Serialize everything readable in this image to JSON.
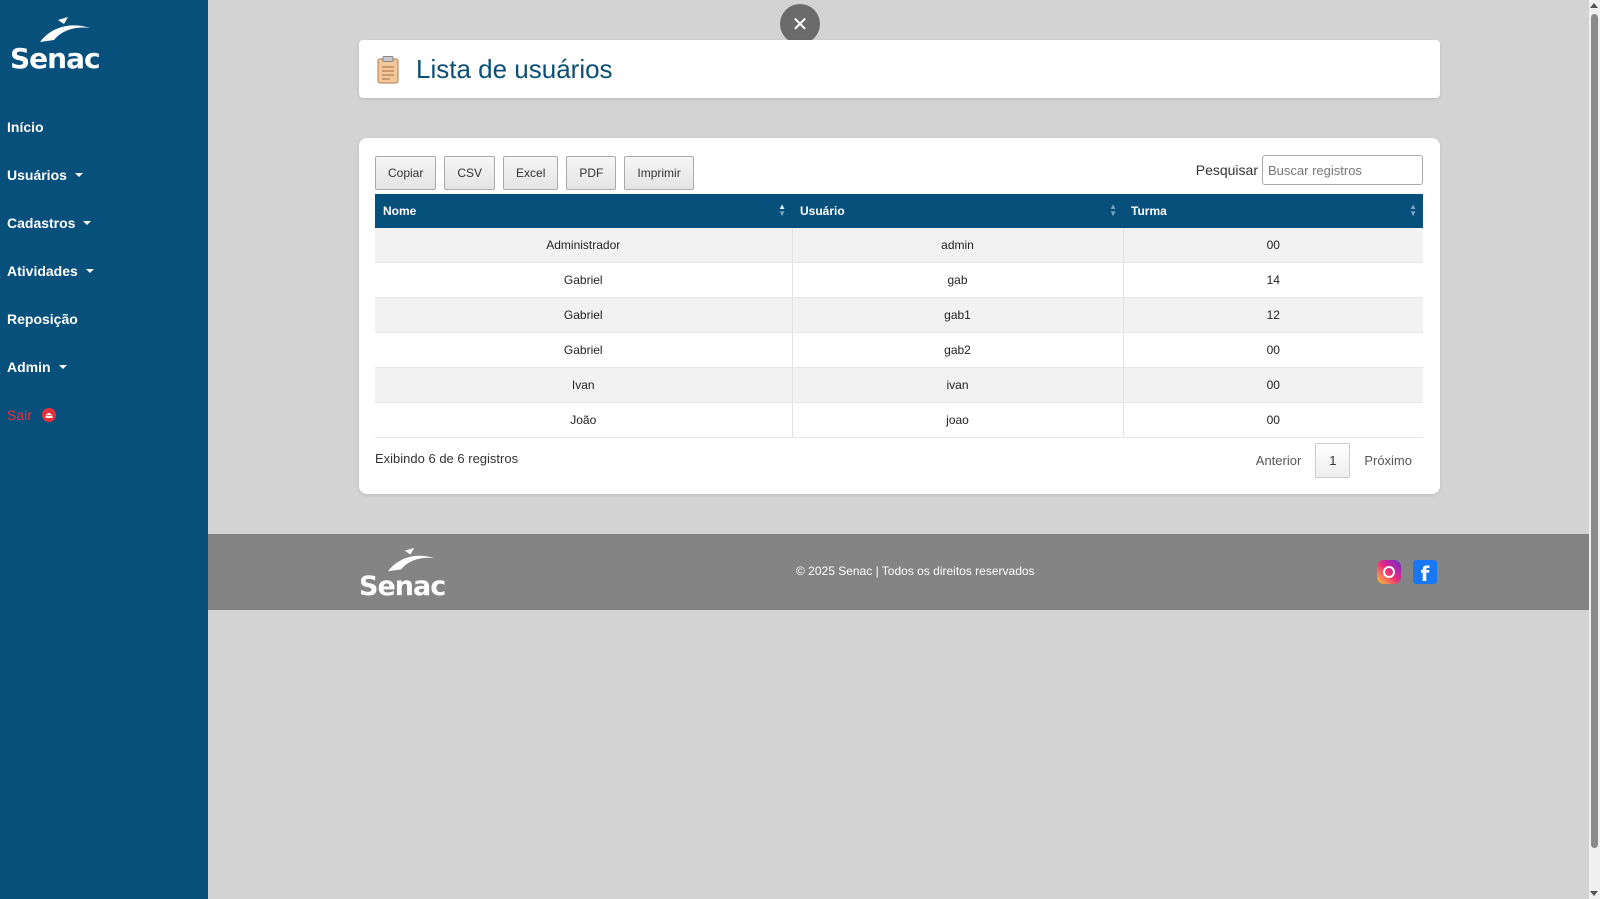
{
  "brand": {
    "logo_text": "Senac"
  },
  "sidebar": {
    "items": [
      {
        "label": "Início",
        "has_caret": false
      },
      {
        "label": "Usuários",
        "has_caret": true
      },
      {
        "label": "Cadastros",
        "has_caret": true
      },
      {
        "label": "Atividades",
        "has_caret": true
      },
      {
        "label": "Reposição",
        "has_caret": false
      },
      {
        "label": "Admin",
        "has_caret": true
      }
    ],
    "logout_label": "Sair"
  },
  "close_button": {
    "icon": "close-icon",
    "glyph": "✕"
  },
  "page": {
    "title": "Lista de usuários",
    "title_icon": "clipboard-icon"
  },
  "toolbar": {
    "buttons": [
      "Copiar",
      "CSV",
      "Excel",
      "PDF",
      "Imprimir"
    ],
    "search_label": "Pesquisar",
    "search_placeholder": "Buscar registros",
    "search_value": ""
  },
  "table": {
    "columns": [
      "Nome",
      "Usuário",
      "Turma"
    ],
    "rows": [
      [
        "Administrador",
        "admin",
        "00"
      ],
      [
        "Gabriel",
        "gab",
        "14"
      ],
      [
        "Gabriel",
        "gab1",
        "12"
      ],
      [
        "Gabriel",
        "gab2",
        "00"
      ],
      [
        "Ivan",
        "ivan",
        "00"
      ],
      [
        "João",
        "joao",
        "00"
      ]
    ]
  },
  "pagination": {
    "info": "Exibindo 6 de 6 registros",
    "previous": "Anterior",
    "current_page": "1",
    "next": "Próximo"
  },
  "footer": {
    "logo_text": "Senac",
    "copyright": "© 2025 Senac | Todos os direitos reservados",
    "social": [
      "instagram-icon",
      "facebook-icon"
    ]
  },
  "colors": {
    "sidebar": "#07507b",
    "table_header": "#07507b",
    "title": "#0b4f74",
    "logout": "#e8303a",
    "footer": "#848484",
    "background": "#d3d3d3"
  }
}
